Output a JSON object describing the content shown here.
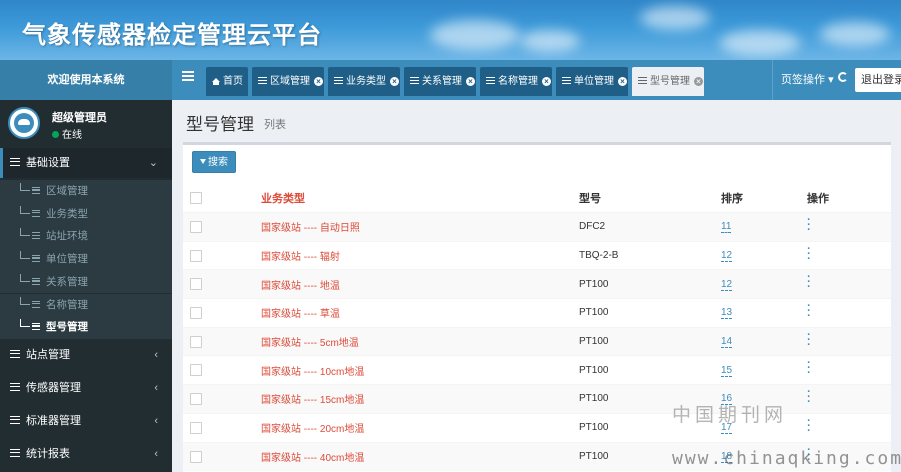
{
  "header": {
    "title": "气象传感器检定管理云平台"
  },
  "topbar": {
    "welcome": "欢迎使用本系统",
    "tabs": [
      {
        "label": "首页",
        "icon": "home-icon",
        "closable": false
      },
      {
        "label": "区域管理",
        "icon": "list-icon",
        "closable": true
      },
      {
        "label": "业务类型",
        "icon": "list-icon",
        "closable": true
      },
      {
        "label": "关系管理",
        "icon": "list-icon",
        "closable": true
      },
      {
        "label": "名称管理",
        "icon": "list-icon",
        "closable": true
      },
      {
        "label": "单位管理",
        "icon": "list-icon",
        "closable": true
      },
      {
        "label": "型号管理",
        "icon": "list-icon",
        "closable": true,
        "active": true
      }
    ],
    "tab_ops": "页签操作",
    "logout": "退出登录"
  },
  "user": {
    "name": "超级管理员",
    "status": "在线"
  },
  "sidebar": {
    "groups": [
      {
        "label": "基础设置",
        "open": true,
        "chevron": "⌄"
      },
      {
        "label": "站点管理",
        "chevron": "‹"
      },
      {
        "label": "传感器管理",
        "chevron": "‹"
      },
      {
        "label": "标准器管理",
        "chevron": "‹"
      },
      {
        "label": "统计报表",
        "chevron": "‹"
      }
    ],
    "sub_items": [
      "区域管理",
      "业务类型",
      "站址环境",
      "单位管理",
      "关系管理",
      "名称管理",
      "型号管理"
    ],
    "active_sub": "型号管理"
  },
  "main": {
    "title": "型号管理",
    "subtitle": "列表",
    "search_label": "搜索",
    "columns": [
      "业务类型",
      "型号",
      "排序",
      "操作"
    ],
    "rows": [
      {
        "type": "国家级站 ---- 自动日照",
        "model": "DFC2",
        "sort": "11"
      },
      {
        "type": "国家级站 ---- 辐射",
        "model": "TBQ-2-B",
        "sort": "12"
      },
      {
        "type": "国家级站 ---- 地温",
        "model": "PT100",
        "sort": "12"
      },
      {
        "type": "国家级站 ---- 草温",
        "model": "PT100",
        "sort": "13"
      },
      {
        "type": "国家级站 ---- 5cm地温",
        "model": "PT100",
        "sort": "14"
      },
      {
        "type": "国家级站 ---- 10cm地温",
        "model": "PT100",
        "sort": "15"
      },
      {
        "type": "国家级站 ---- 15cm地温",
        "model": "PT100",
        "sort": "16"
      },
      {
        "type": "国家级站 ---- 20cm地温",
        "model": "PT100",
        "sort": "17"
      },
      {
        "type": "国家级站 ---- 40cm地温",
        "model": "PT100",
        "sort": "18"
      }
    ]
  },
  "watermark": {
    "line1": "中国期刊网",
    "line2": "www.chinaqking.com"
  },
  "colors": {
    "brand": "#3c8dbc",
    "danger": "#dd4b39",
    "sidebar": "#222d32"
  }
}
